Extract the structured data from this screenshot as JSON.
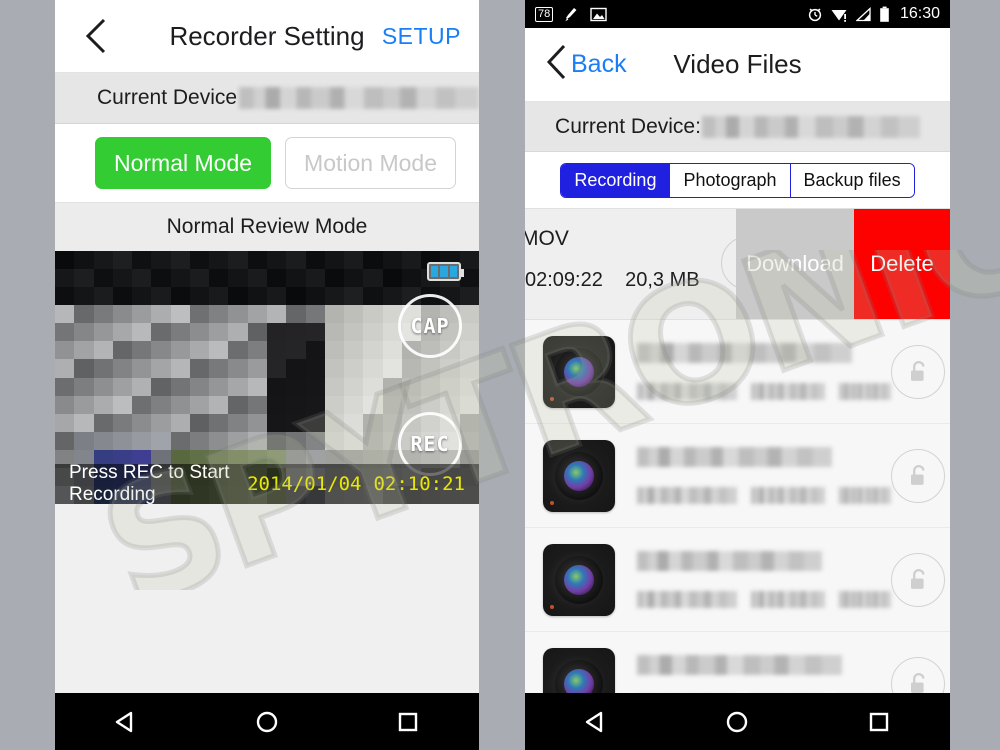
{
  "background_color": "#a9adb3",
  "watermark": {
    "text": "SPYTRONIC"
  },
  "left_phone": {
    "header": {
      "back_icon": "chevron-left-icon",
      "title": "Recorder Setting",
      "setup_label": "SETUP"
    },
    "device_bar": {
      "label": "Current Device",
      "value_blurred": true
    },
    "modes": [
      {
        "label": "Normal Mode",
        "active": true,
        "color": "#33cc33"
      },
      {
        "label": "Motion Mode",
        "active": false,
        "color": "#c8c8c8"
      }
    ],
    "review_mode_label": "Normal Review Mode",
    "video": {
      "battery_icon": "battery-icon",
      "cap_button": "CAP",
      "rec_button": "REC",
      "status_message": "Press REC to Start Recording",
      "date": "2014/01/04",
      "time": "02:10:21"
    }
  },
  "right_phone": {
    "statusbar": {
      "badge": "78",
      "icons": [
        "broom-icon",
        "image-icon"
      ],
      "right_icons": [
        "alarm-icon",
        "wifi-warning-icon",
        "signal-icon",
        "battery-icon"
      ],
      "clock": "16:30"
    },
    "header": {
      "back_icon": "chevron-left-icon",
      "back_label": "Back",
      "title": "Video Files"
    },
    "device_bar": {
      "label": "Current Device:",
      "value_blurred": true
    },
    "tabs": [
      {
        "label": "Recording",
        "active": true
      },
      {
        "label": "Photograph",
        "active": false
      },
      {
        "label": "Backup files",
        "active": false
      }
    ],
    "tab_accent_color": "#2020e0",
    "swiped_row": {
      "filename": "MOV",
      "duration": "02:09:22",
      "size": "20,3 MB",
      "lock_icon": "lock-closed-icon",
      "download_label": "Download",
      "delete_label": "Delete",
      "delete_color": "#fd0000",
      "download_color": "#c9c9c9"
    },
    "file_rows": [
      {
        "thumbnail": "camera-lens-icon",
        "name_blurred": true,
        "meta_blurred": true,
        "lock_icon": "lock-open-icon"
      },
      {
        "thumbnail": "camera-lens-icon",
        "name_blurred": true,
        "meta_blurred": true,
        "lock_icon": "lock-open-icon"
      },
      {
        "thumbnail": "camera-lens-icon",
        "name_blurred": true,
        "meta_blurred": true,
        "lock_icon": "lock-open-icon"
      },
      {
        "thumbnail": "camera-lens-icon",
        "name_blurred": true,
        "meta_blurred": true,
        "lock_icon": "lock-open-icon"
      }
    ]
  },
  "android_nav": {
    "back": "triangle-back-icon",
    "home": "circle-home-icon",
    "recents": "square-recents-icon"
  }
}
